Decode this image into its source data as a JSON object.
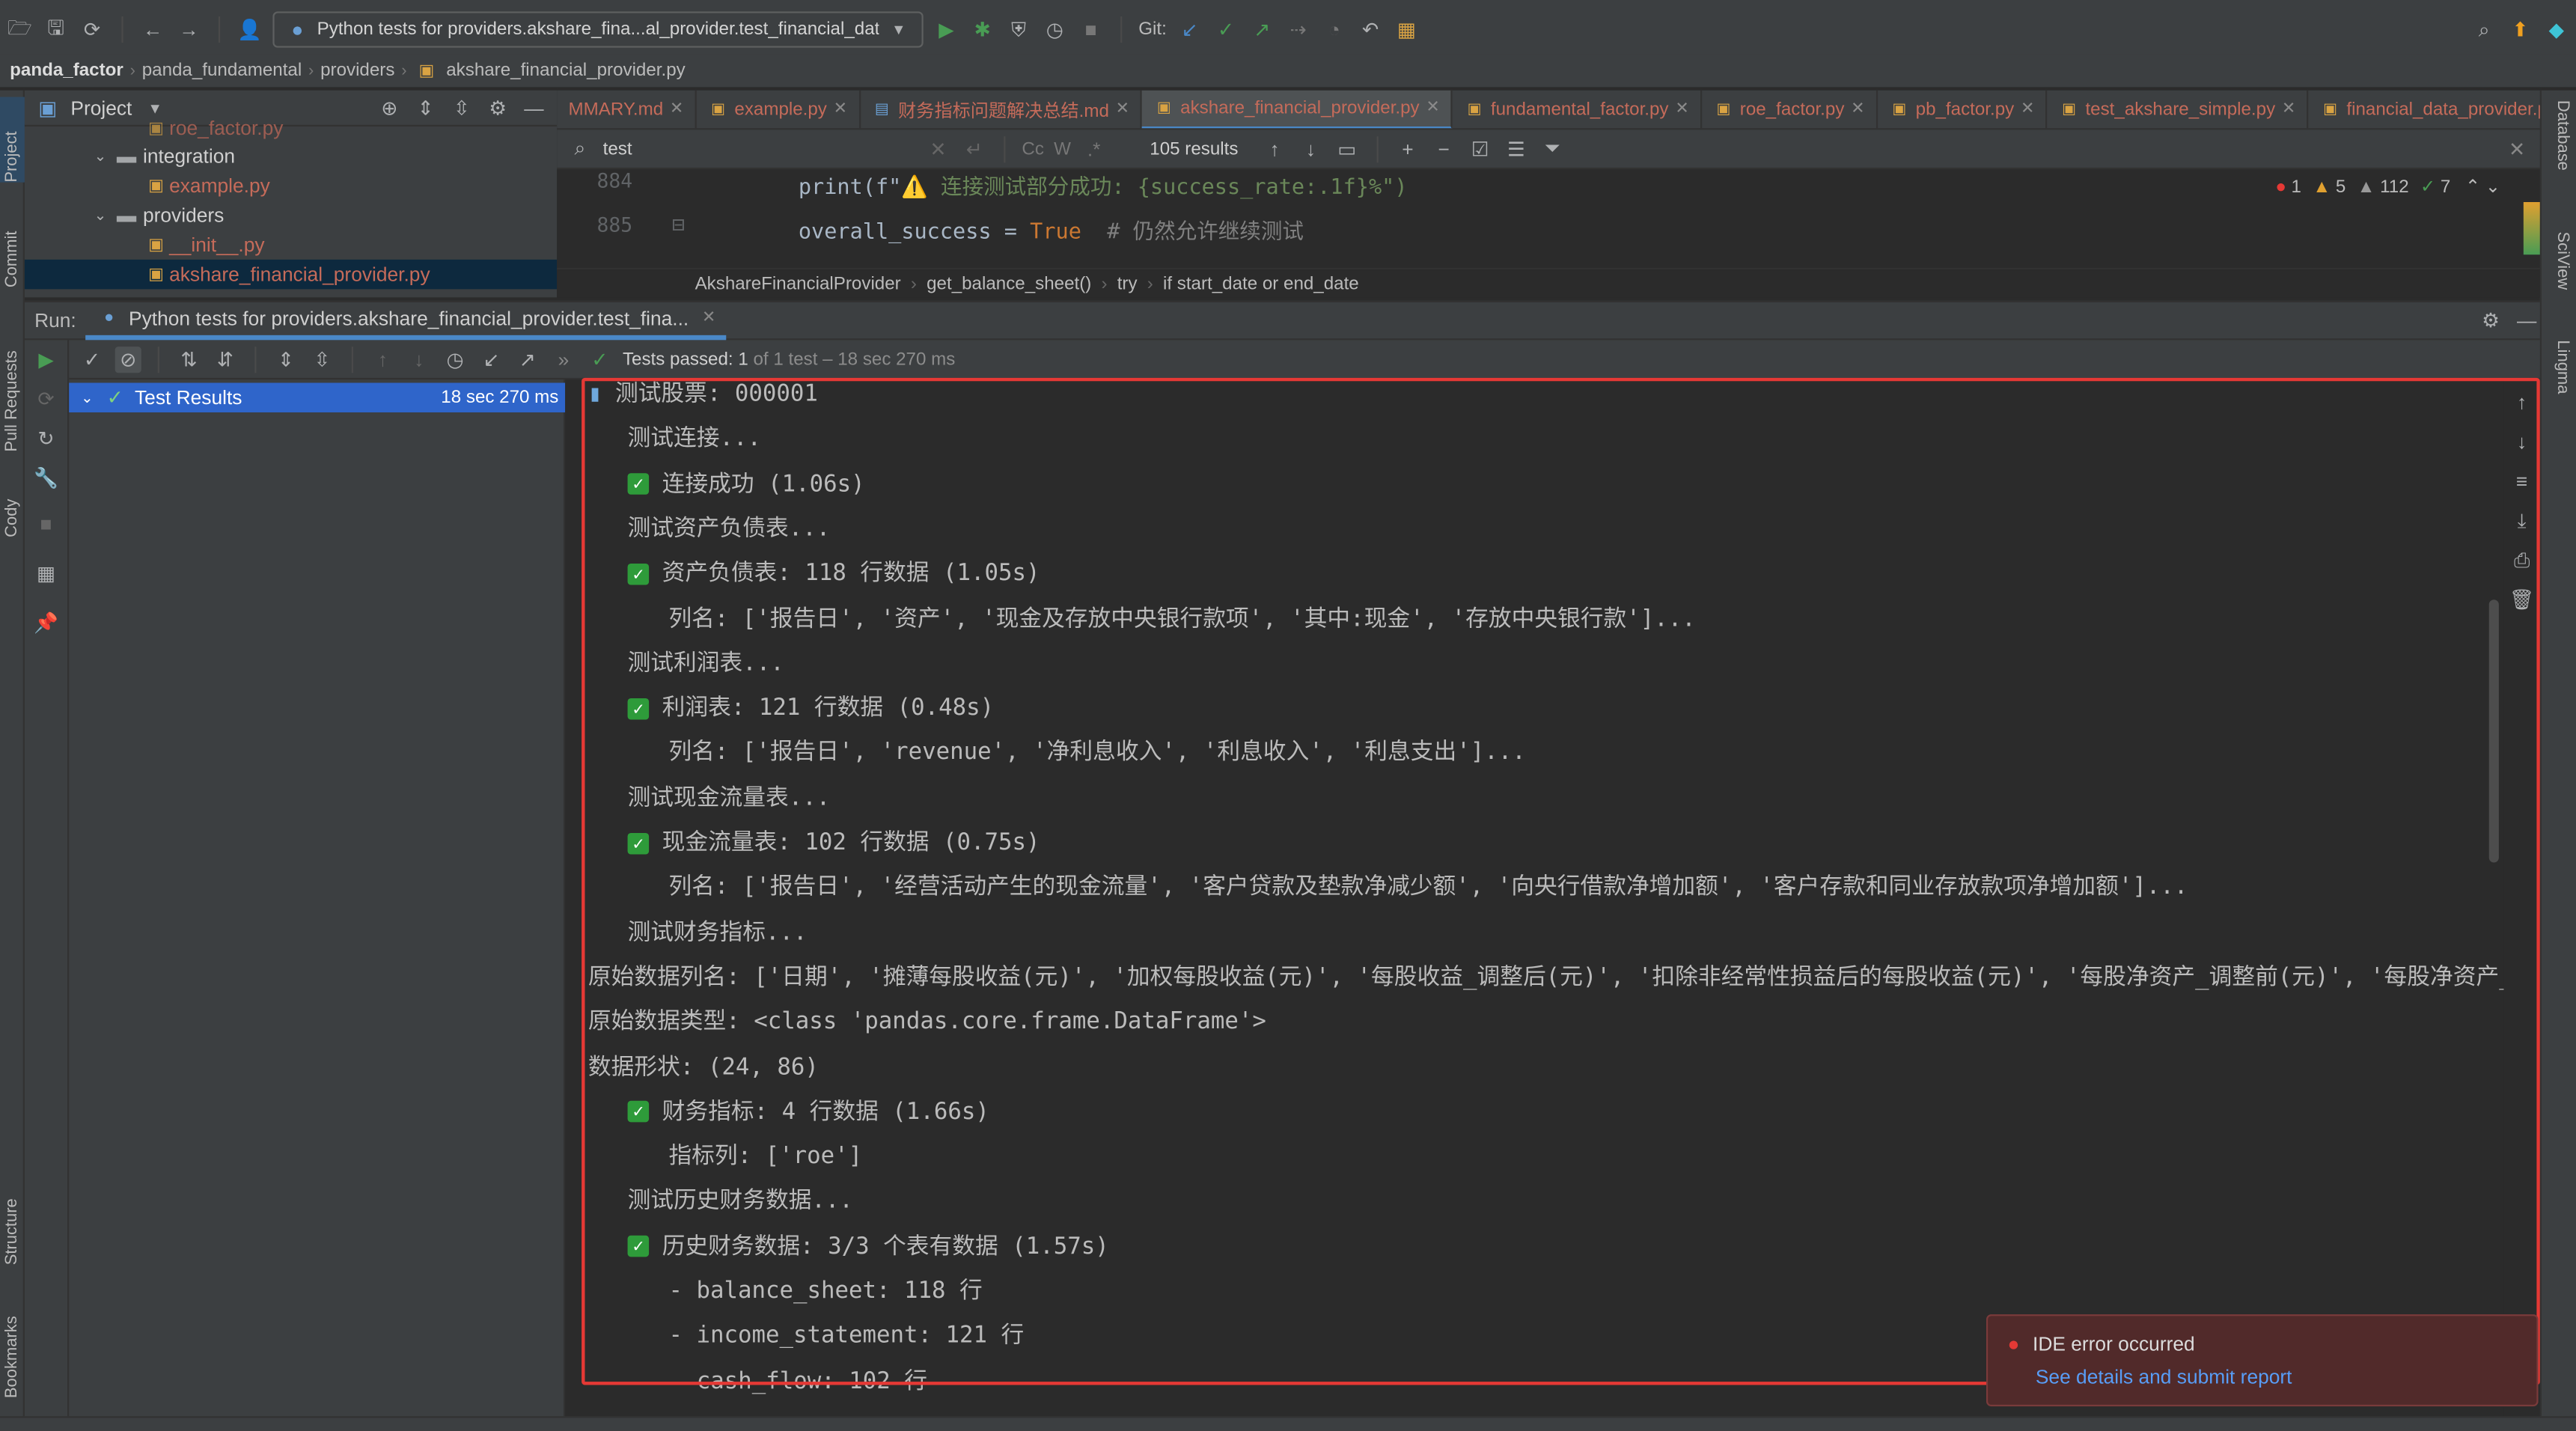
{
  "toolbar": {
    "run_config": "Python tests for providers.akshare_fina...al_provider.test_financial_data_provider",
    "git_label": "Git:"
  },
  "breadcrumb": [
    "panda_factor",
    "panda_fundamental",
    "providers",
    "akshare_financial_provider.py"
  ],
  "left_strip": [
    "Project",
    "Commit",
    "Pull Requests",
    "Cody",
    "Structure",
    "Bookmarks"
  ],
  "right_strip": [
    "Database",
    "SciView",
    "Lingma"
  ],
  "project_panel": {
    "title": "Project",
    "items": [
      {
        "label": "roe_factor.py",
        "type": "py"
      },
      {
        "label": "integration",
        "type": "folder"
      },
      {
        "label": "example.py",
        "type": "py"
      },
      {
        "label": "providers",
        "type": "folder"
      },
      {
        "label": "__init__.py",
        "type": "py"
      },
      {
        "label": "akshare_financial_provider.py",
        "type": "py"
      }
    ]
  },
  "editor": {
    "tabs": [
      {
        "label": "MMARY.md",
        "active": false
      },
      {
        "label": "example.py",
        "active": false
      },
      {
        "label": "财务指标问题解决总结.md",
        "active": false
      },
      {
        "label": "akshare_financial_provider.py",
        "active": true
      },
      {
        "label": "fundamental_factor.py",
        "active": false
      },
      {
        "label": "roe_factor.py",
        "active": false
      },
      {
        "label": "pb_factor.py",
        "active": false
      },
      {
        "label": "test_akshare_simple.py",
        "active": false
      },
      {
        "label": "financial_data_provider.py",
        "active": false
      }
    ],
    "find": {
      "query": "test",
      "results": "105 results",
      "cc": "Cc",
      "w": "W"
    },
    "inspections": {
      "errors": "1",
      "warnings": "5",
      "weak_warnings": "112",
      "ok": "7"
    },
    "lines": [
      {
        "num": "884",
        "pre": "print(f\"",
        "warn": "⚠️ 连接测试部分成功: {success_rate:.1f}%\")",
        "cmt": ""
      },
      {
        "num": "885",
        "pre": "overall_success = ",
        "kw": "True",
        "cmt": "  # 仍然允许继续测试"
      }
    ],
    "structure_crumb": [
      "AkshareFinancialProvider",
      "get_balance_sheet()",
      "try",
      "if start_date or end_date"
    ]
  },
  "run": {
    "label": "Run:",
    "tab": "Python tests for providers.akshare_financial_provider.test_fina...",
    "status_bold": "Tests passed: 1",
    "status_rest": "of 1 test – 18 sec 270 ms",
    "result_label": "Test Results",
    "result_time": "18 sec 270 ms"
  },
  "console": [
    {
      "indent": 0,
      "icon": "chart",
      "text": "测试股票: 000001"
    },
    {
      "indent": 1,
      "icon": "",
      "text": "测试连接..."
    },
    {
      "indent": 1,
      "icon": "check",
      "text": "连接成功 (1.06s)"
    },
    {
      "indent": 1,
      "icon": "",
      "text": "测试资产负债表..."
    },
    {
      "indent": 1,
      "icon": "check",
      "text": "资产负债表: 118 行数据 (1.05s)"
    },
    {
      "indent": 2,
      "icon": "",
      "text": "列名: ['报告日', '资产', '现金及存放中央银行款项', '其中:现金', '存放中央银行款']..."
    },
    {
      "indent": 1,
      "icon": "",
      "text": "测试利润表..."
    },
    {
      "indent": 1,
      "icon": "check",
      "text": "利润表: 121 行数据 (0.48s)"
    },
    {
      "indent": 2,
      "icon": "",
      "text": "列名: ['报告日', 'revenue', '净利息收入', '利息收入', '利息支出']..."
    },
    {
      "indent": 1,
      "icon": "",
      "text": "测试现金流量表..."
    },
    {
      "indent": 1,
      "icon": "check",
      "text": "现金流量表: 102 行数据 (0.75s)"
    },
    {
      "indent": 2,
      "icon": "",
      "text": "列名: ['报告日', '经营活动产生的现金流量', '客户贷款及垫款净减少额', '向央行借款净增加额', '客户存款和同业存放款项净增加额']..."
    },
    {
      "indent": 1,
      "icon": "",
      "text": "测试财务指标..."
    },
    {
      "indent": -1,
      "icon": "",
      "text": "原始数据列名: ['日期', '摊薄每股收益(元)', '加权每股收益(元)', '每股收益_调整后(元)', '扣除非经常性损益后的每股收益(元)', '每股净资产_调整前(元)', '每股净资产_调整"
    },
    {
      "indent": -1,
      "icon": "",
      "text": "原始数据类型: <class 'pandas.core.frame.DataFrame'>"
    },
    {
      "indent": -1,
      "icon": "",
      "text": "数据形状: (24, 86)"
    },
    {
      "indent": 1,
      "icon": "check",
      "text": "财务指标: 4 行数据 (1.66s)"
    },
    {
      "indent": 2,
      "icon": "",
      "text": "指标列: ['roe']"
    },
    {
      "indent": 1,
      "icon": "",
      "text": "测试历史财务数据..."
    },
    {
      "indent": 1,
      "icon": "check",
      "text": "历史财务数据: 3/3 个表有数据 (1.57s)"
    },
    {
      "indent": 2,
      "icon": "",
      "text": "- balance_sheet: 118 行"
    },
    {
      "indent": 2,
      "icon": "",
      "text": "- income_statement: 121 行"
    },
    {
      "indent": 3,
      "icon": "",
      "text": "cash_flow: 102 行"
    }
  ],
  "toast": {
    "title": "IDE error occurred",
    "link": "See details and submit report"
  },
  "colors": {
    "accent": "#4a88c7",
    "error": "#e53935",
    "ok": "#499c54"
  }
}
